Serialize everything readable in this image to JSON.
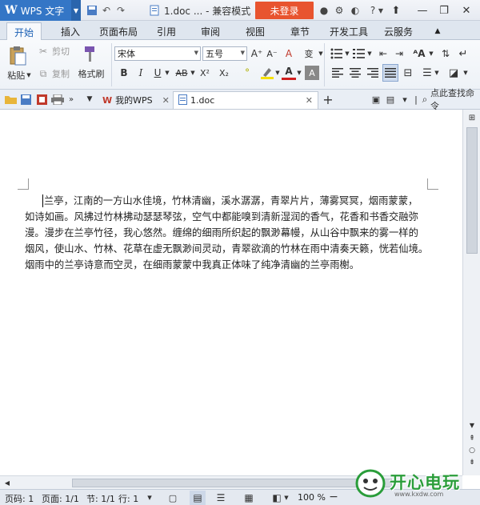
{
  "titlebar": {
    "app_name": "WPS 文字",
    "doc_title": "1.doc ... - 兼容模式",
    "login_label": "未登录",
    "help": "?"
  },
  "tabs": [
    {
      "label": "开始",
      "active": true
    },
    {
      "label": "插入"
    },
    {
      "label": "页面布局"
    },
    {
      "label": "引用"
    },
    {
      "label": "审阅"
    },
    {
      "label": "视图"
    },
    {
      "label": "章节"
    },
    {
      "label": "开发工具"
    },
    {
      "label": "云服务"
    }
  ],
  "ribbon": {
    "paste": "粘贴",
    "cut": "剪切",
    "copy": "复制",
    "format_painter": "格式刷",
    "font_name": "宋体",
    "font_size": "五号",
    "bold": "B",
    "italic": "I",
    "underline": "U",
    "strike": "AB",
    "superscript": "X²",
    "subscript": "X₂",
    "font_color": "A",
    "char_shade": "A",
    "grow": "A⁺",
    "shrink": "A⁻",
    "clear": "A",
    "pinyin": "变"
  },
  "doc_tabs": {
    "my_wps": "我的WPS",
    "doc": "1.doc",
    "add": "+",
    "find_label": "点此查找命令"
  },
  "document": {
    "lines": [
      "兰亭，江南的一方山水佳境，竹林清幽，溪水潺潺，青翠片片，薄雾冥冥，烟雨蒙蒙，",
      "如诗如画。风拂过竹林拂动瑟瑟琴弦，空气中都能嗅到清新湿润的香气，花香和书香交融弥",
      "漫。漫步在兰亭竹径，我心悠然。缠绵的细雨所织起的飘渺幕幔，从山谷中飘来的雾一样的",
      "烟风，使山水、竹林、花草在虚无飘渺间灵动，青翠欲滴的竹林在雨中清奏天籁，恍若仙境。",
      "烟雨中的兰亭诗意而空灵，在细雨蒙蒙中我真正体味了纯净清幽的兰亭雨榭。"
    ]
  },
  "status": {
    "page_code": "页码: 1",
    "page": "页面: 1/1",
    "section": "节: 1/1",
    "row": "行: 1",
    "zoom": "100 %"
  },
  "watermark": {
    "text": "开心电玩",
    "sub": "www.kxdw.com"
  },
  "colors": {
    "accent": "#3476c6",
    "login": "#e8542f",
    "logo_green": "#2a9d3a"
  }
}
